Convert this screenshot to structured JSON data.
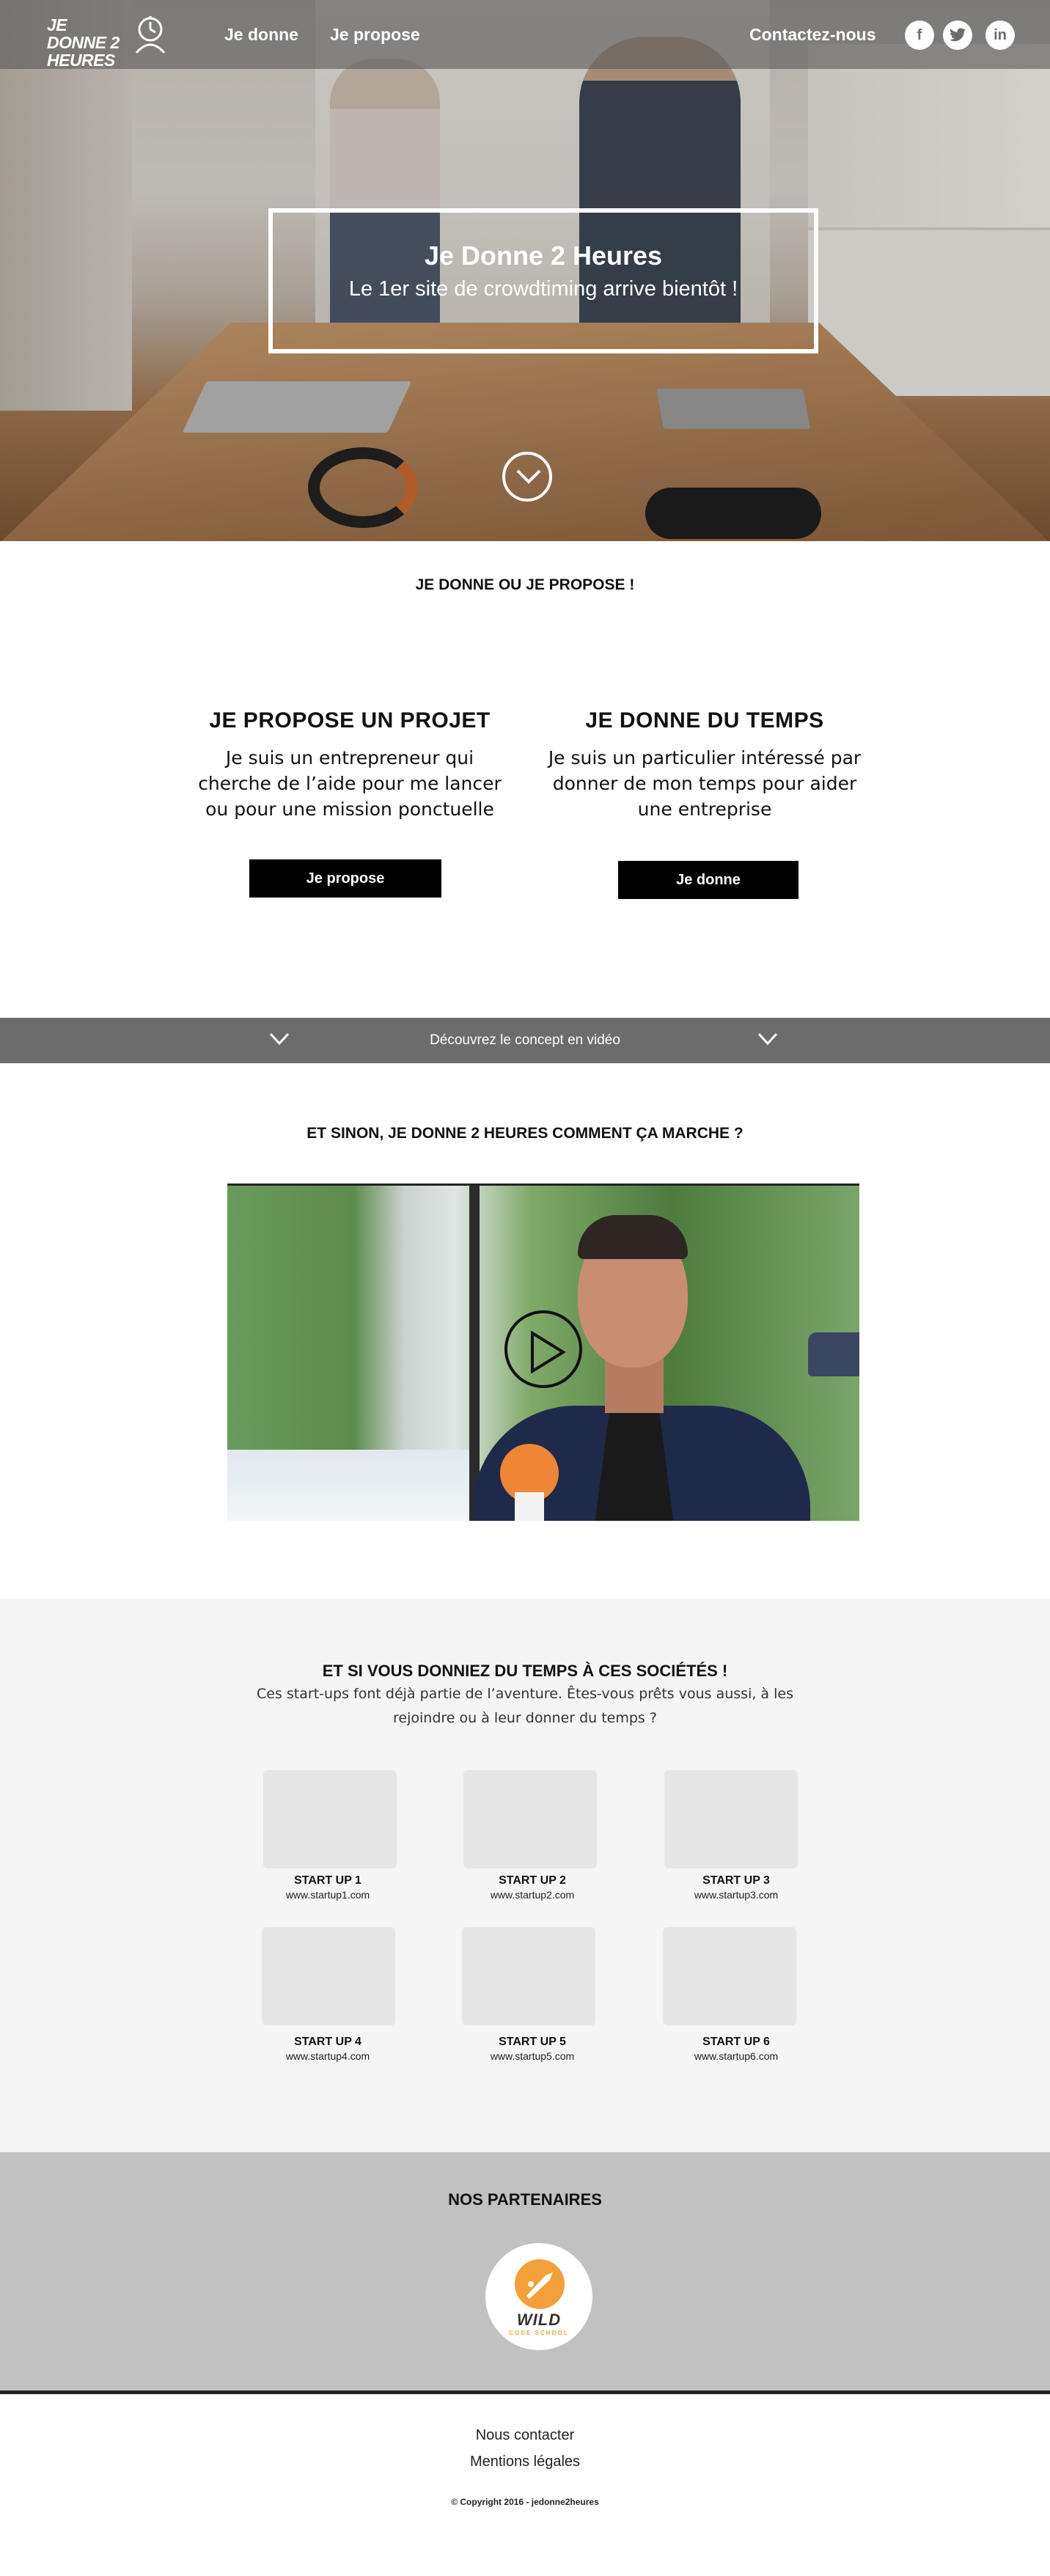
{
  "nav": {
    "logo_text": "JE DONNE 2 HEURES",
    "link_donne": "Je donne",
    "link_propose": "Je propose",
    "link_contact": "Contactez-nous",
    "social": {
      "facebook": "f",
      "twitter": "t",
      "linkedin": "in"
    }
  },
  "hero": {
    "title": "Je Donne 2 Heures",
    "subtitle": "Le 1er site de crowdtiming arrive bientôt !"
  },
  "choice": {
    "heading": "JE DONNE OU JE PROPOSE !",
    "propose": {
      "title": "JE PROPOSE UN PROJET",
      "text": "Je suis un entrepreneur qui cherche de l’aide pour me lancer ou pour une mission ponctuelle",
      "button": "Je propose"
    },
    "donne": {
      "title": "JE DONNE DU TEMPS",
      "text": "Je suis un particulier intéressé par donner de mon temps pour aider une entreprise",
      "button": "Je donne"
    }
  },
  "video_bar": {
    "text": "Découvrez le concept en vidéo"
  },
  "how": {
    "heading": "ET SINON, JE DONNE 2 HEURES COMMENT ÇA MARCHE ?"
  },
  "startups": {
    "heading": "ET SI VOUS DONNIEZ DU TEMPS À CES SOCIÉTÉS !",
    "subtitle": "Ces start-ups font déjà partie de l’aventure. Êtes-vous prêts vous aussi,  à les rejoindre ou à leur donner du temps ?",
    "items": [
      {
        "name": "START UP 1",
        "url": "www.startup1.com"
      },
      {
        "name": "START UP 2",
        "url": "www.startup2.com"
      },
      {
        "name": "START UP 3",
        "url": "www.startup3.com"
      },
      {
        "name": "START UP 4",
        "url": "www.startup4.com"
      },
      {
        "name": "START UP 5",
        "url": "www.startup5.com"
      },
      {
        "name": "START UP 6",
        "url": "www.startup6.com"
      }
    ]
  },
  "partners": {
    "heading": "NOS PARTENAIRES",
    "logo_wild": "WILD",
    "logo_school": "CODE SCHOOL"
  },
  "footer": {
    "contact": "Nous contacter",
    "legal": "Mentions légales",
    "copyright": "© Copyright 2016 - jedonne2heures"
  }
}
